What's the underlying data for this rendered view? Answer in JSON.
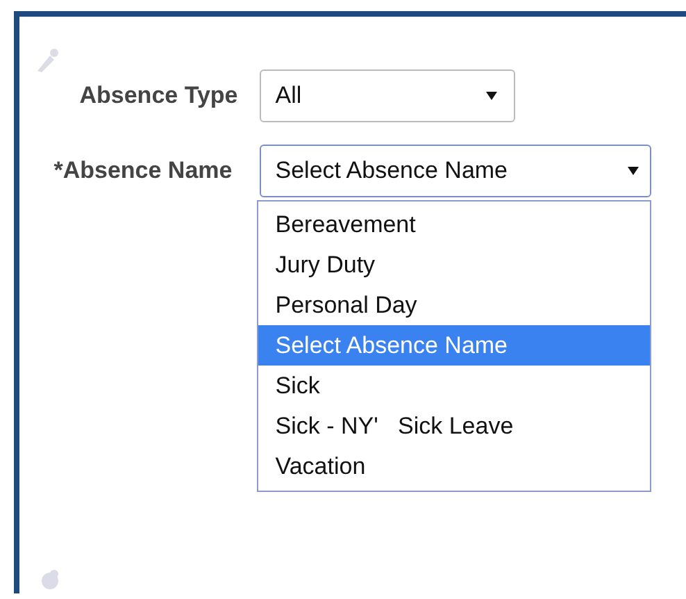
{
  "fields": [
    {
      "label": "Absence Type",
      "value": "All",
      "open": false
    },
    {
      "label": "*Absence Name",
      "value": "Select Absence Name",
      "open": true,
      "options": [
        {
          "label": "Bereavement",
          "selected": false
        },
        {
          "label": "Jury Duty",
          "selected": false
        },
        {
          "label": "Personal Day",
          "selected": false
        },
        {
          "label": "Select Absence Name",
          "selected": true
        },
        {
          "label": "Sick",
          "selected": false
        },
        {
          "label": "Sick - NY'   Sick Leave",
          "selected": false
        },
        {
          "label": "Vacation",
          "selected": false
        }
      ]
    }
  ]
}
